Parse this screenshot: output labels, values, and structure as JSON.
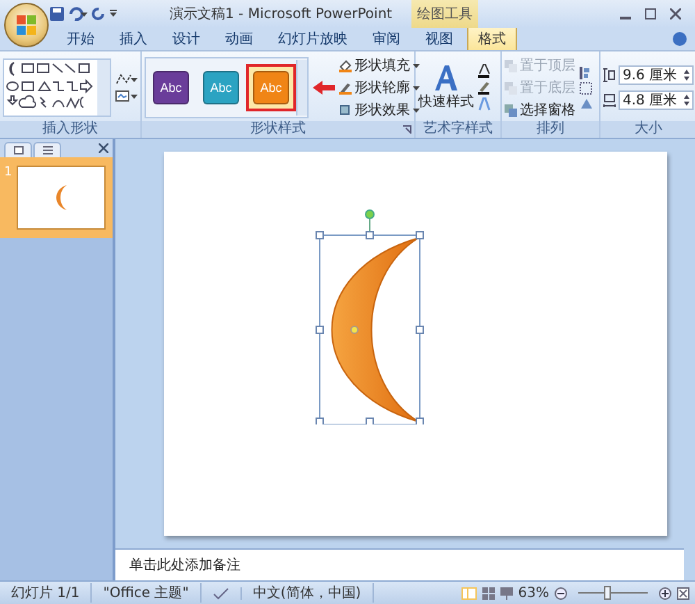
{
  "window": {
    "title": "演示文稿1 - Microsoft PowerPoint",
    "context_tab": "绘图工具"
  },
  "tabs": [
    {
      "label": "开始",
      "selected": false
    },
    {
      "label": "插入",
      "selected": false
    },
    {
      "label": "设计",
      "selected": false
    },
    {
      "label": "动画",
      "selected": false
    },
    {
      "label": "幻灯片放映",
      "selected": false
    },
    {
      "label": "审阅",
      "selected": false
    },
    {
      "label": "视图",
      "selected": false
    },
    {
      "label": "格式",
      "selected": true
    }
  ],
  "ribbon": {
    "insert_shapes": {
      "label": "插入形状"
    },
    "shape_styles": {
      "label": "形状样式",
      "styles": [
        {
          "text": "Abc",
          "color": "#6a3d9a",
          "selected": false
        },
        {
          "text": "Abc",
          "color": "#2ba3c2",
          "selected": false
        },
        {
          "text": "Abc",
          "color": "#f08516",
          "selected": true
        }
      ],
      "commands": [
        "形状填充",
        "形状轮廓",
        "形状效果"
      ]
    },
    "wordart_styles": {
      "label": "艺术字样式",
      "quick_styles": "快速样式"
    },
    "arrange": {
      "label": "排列",
      "commands": [
        {
          "label": "置于顶层",
          "disabled": true
        },
        {
          "label": "置于底层",
          "disabled": true
        },
        {
          "label": "选择窗格",
          "disabled": false
        }
      ]
    },
    "size": {
      "label": "大小",
      "height": "9.6 厘米",
      "width": "4.8 厘米"
    }
  },
  "slides_pane": {
    "slides": [
      {
        "number": "1",
        "selected": true
      }
    ]
  },
  "notes": {
    "placeholder": "单击此处添加备注"
  },
  "status_bar": {
    "slide": "幻灯片 1/1",
    "theme": "\"Office 主题\"",
    "language": "中文(简体，中国)",
    "zoom": "63%",
    "zoom_slider": {
      "level": 0.42
    }
  }
}
